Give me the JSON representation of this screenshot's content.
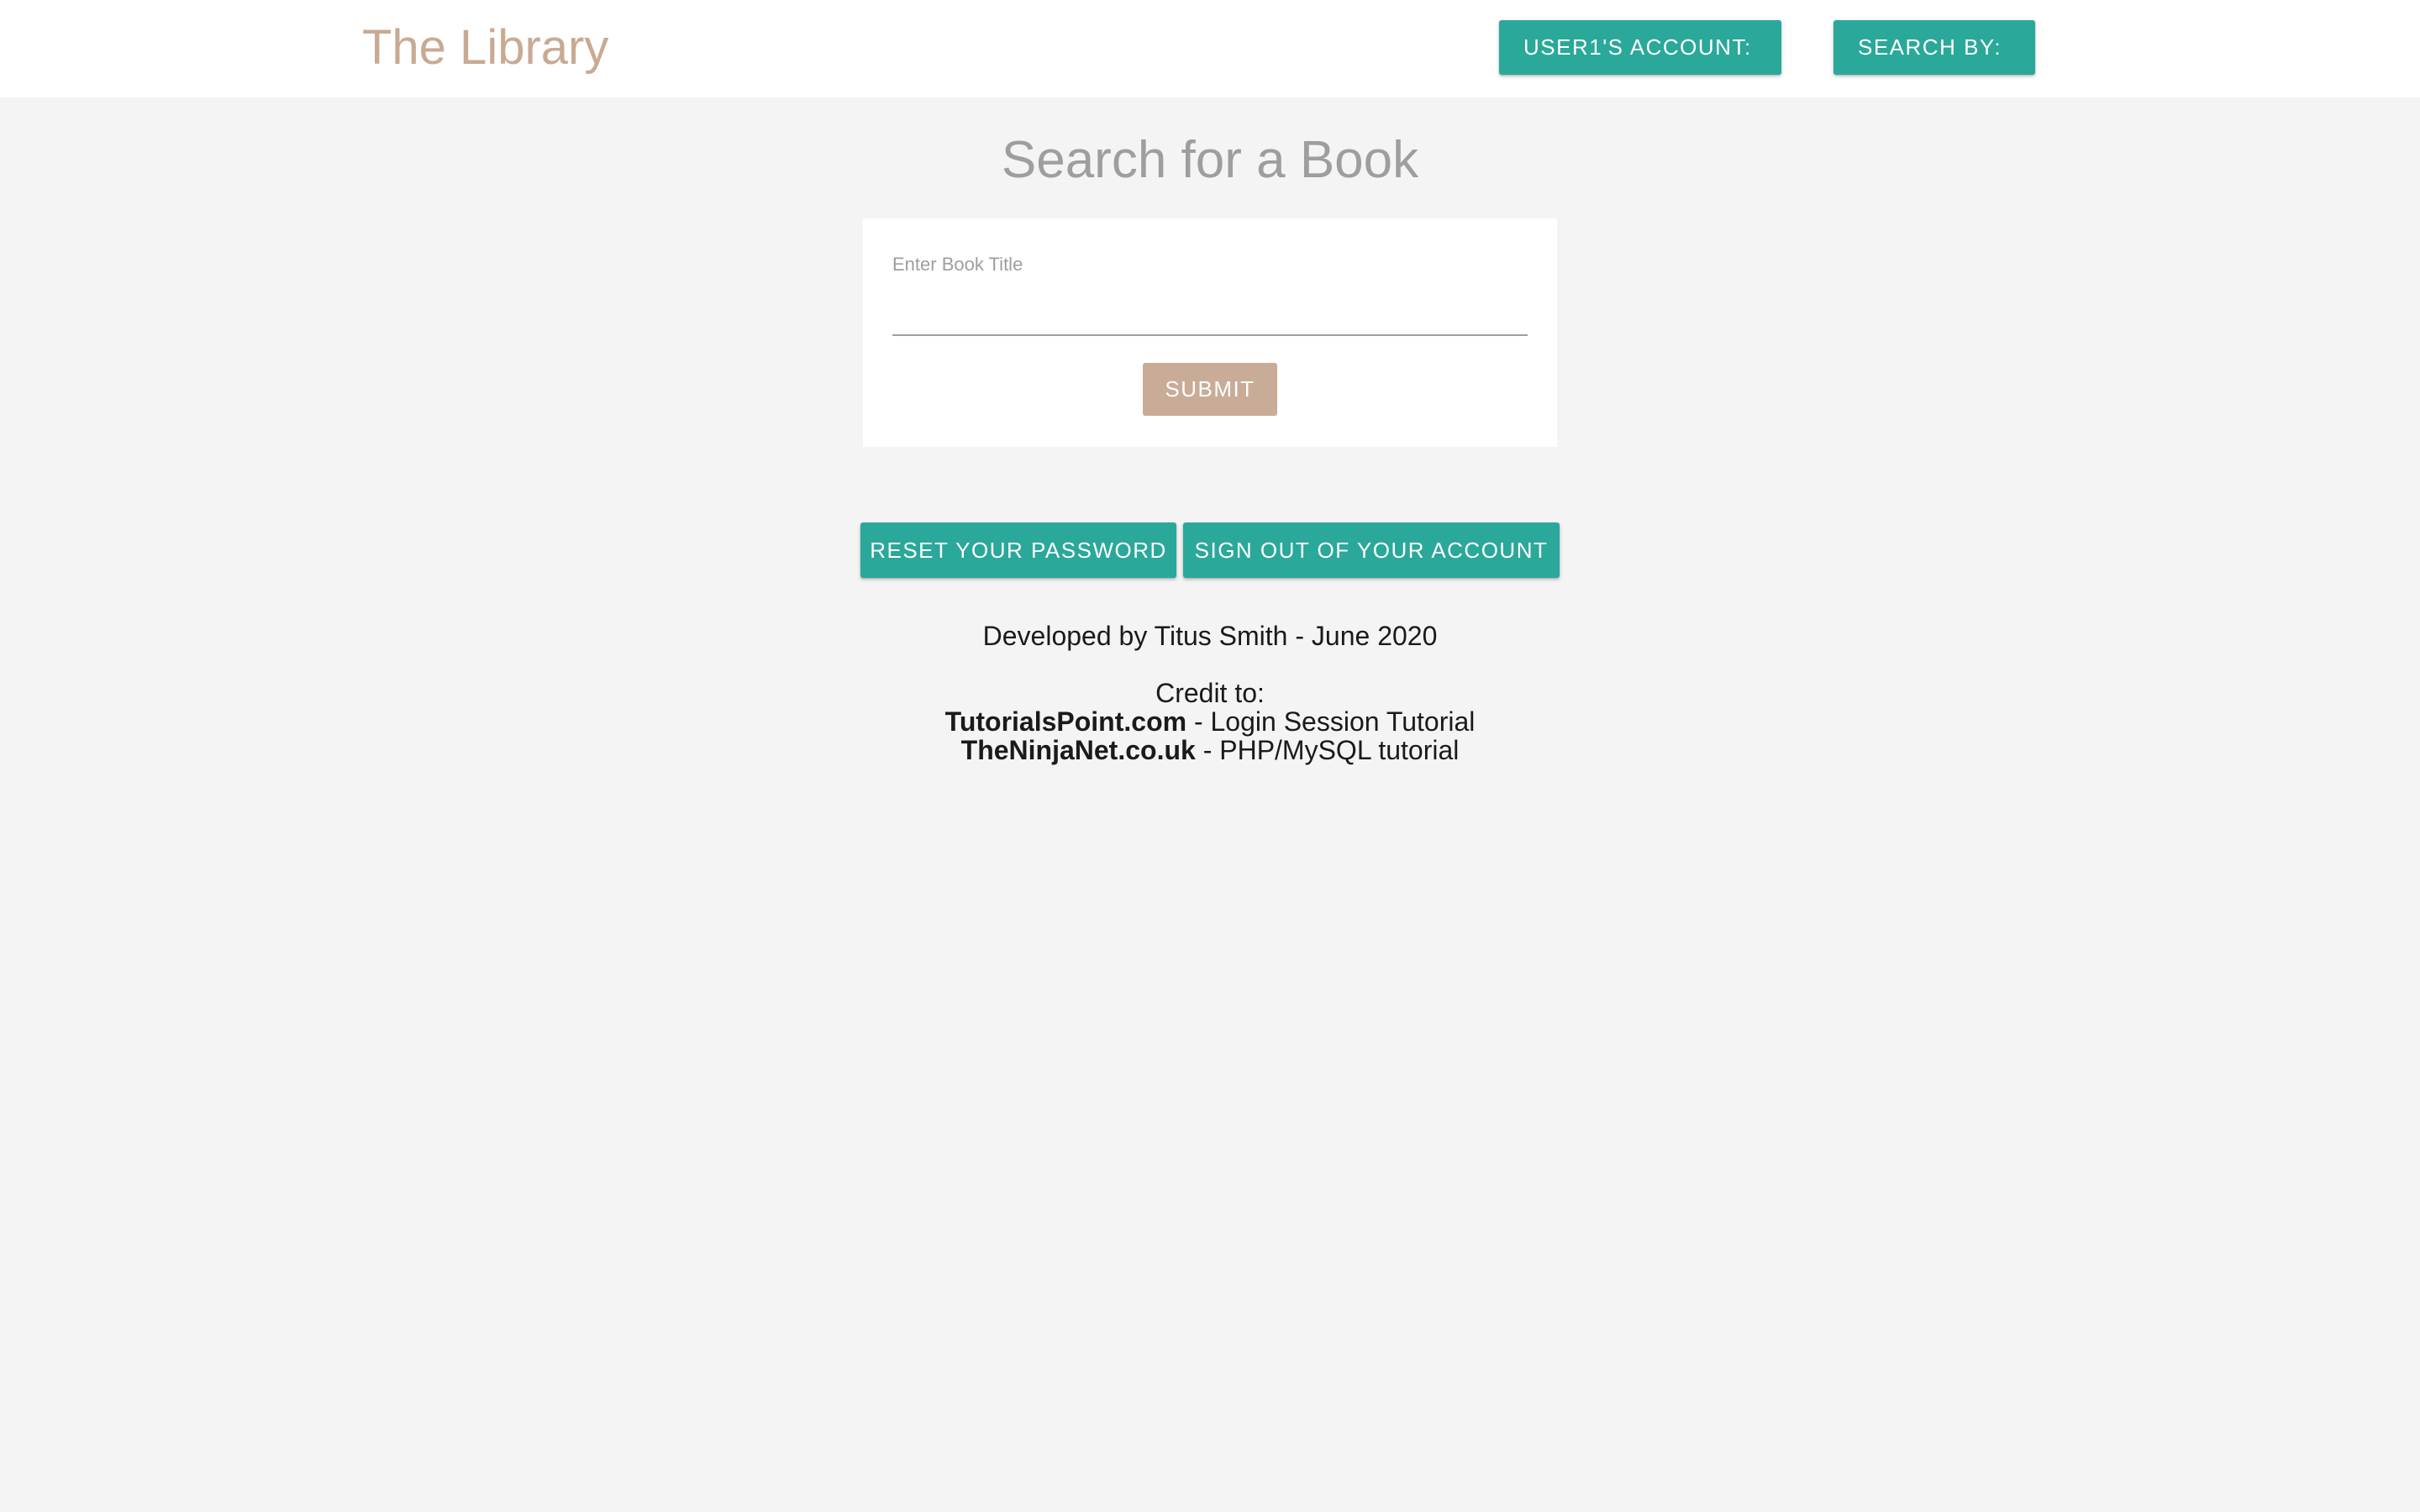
{
  "navbar": {
    "brand": "The Library",
    "account_button": "USER1'S ACCOUNT:",
    "search_by_button": "SEARCH BY:"
  },
  "main": {
    "title": "Search for a Book",
    "search_form": {
      "label": "Enter Book Title",
      "value": "",
      "submit_label": "SUBMIT"
    },
    "actions": {
      "reset_password": "RESET YOUR PASSWORD",
      "sign_out": "SIGN OUT OF YOUR ACCOUNT"
    }
  },
  "footer": {
    "developed_by": "Developed by Titus Smith - June 2020",
    "credit_heading": "Credit to:",
    "credits": [
      {
        "site": "TutorialsPoint.com",
        "description": " - Login Session Tutorial"
      },
      {
        "site": "TheNinjaNet.co.uk",
        "description": " - PHP/MySQL tutorial"
      }
    ]
  },
  "colors": {
    "teal_button": "#2aa89a",
    "tan_accent": "#c8aa93",
    "page_background": "#f4f4f4"
  }
}
